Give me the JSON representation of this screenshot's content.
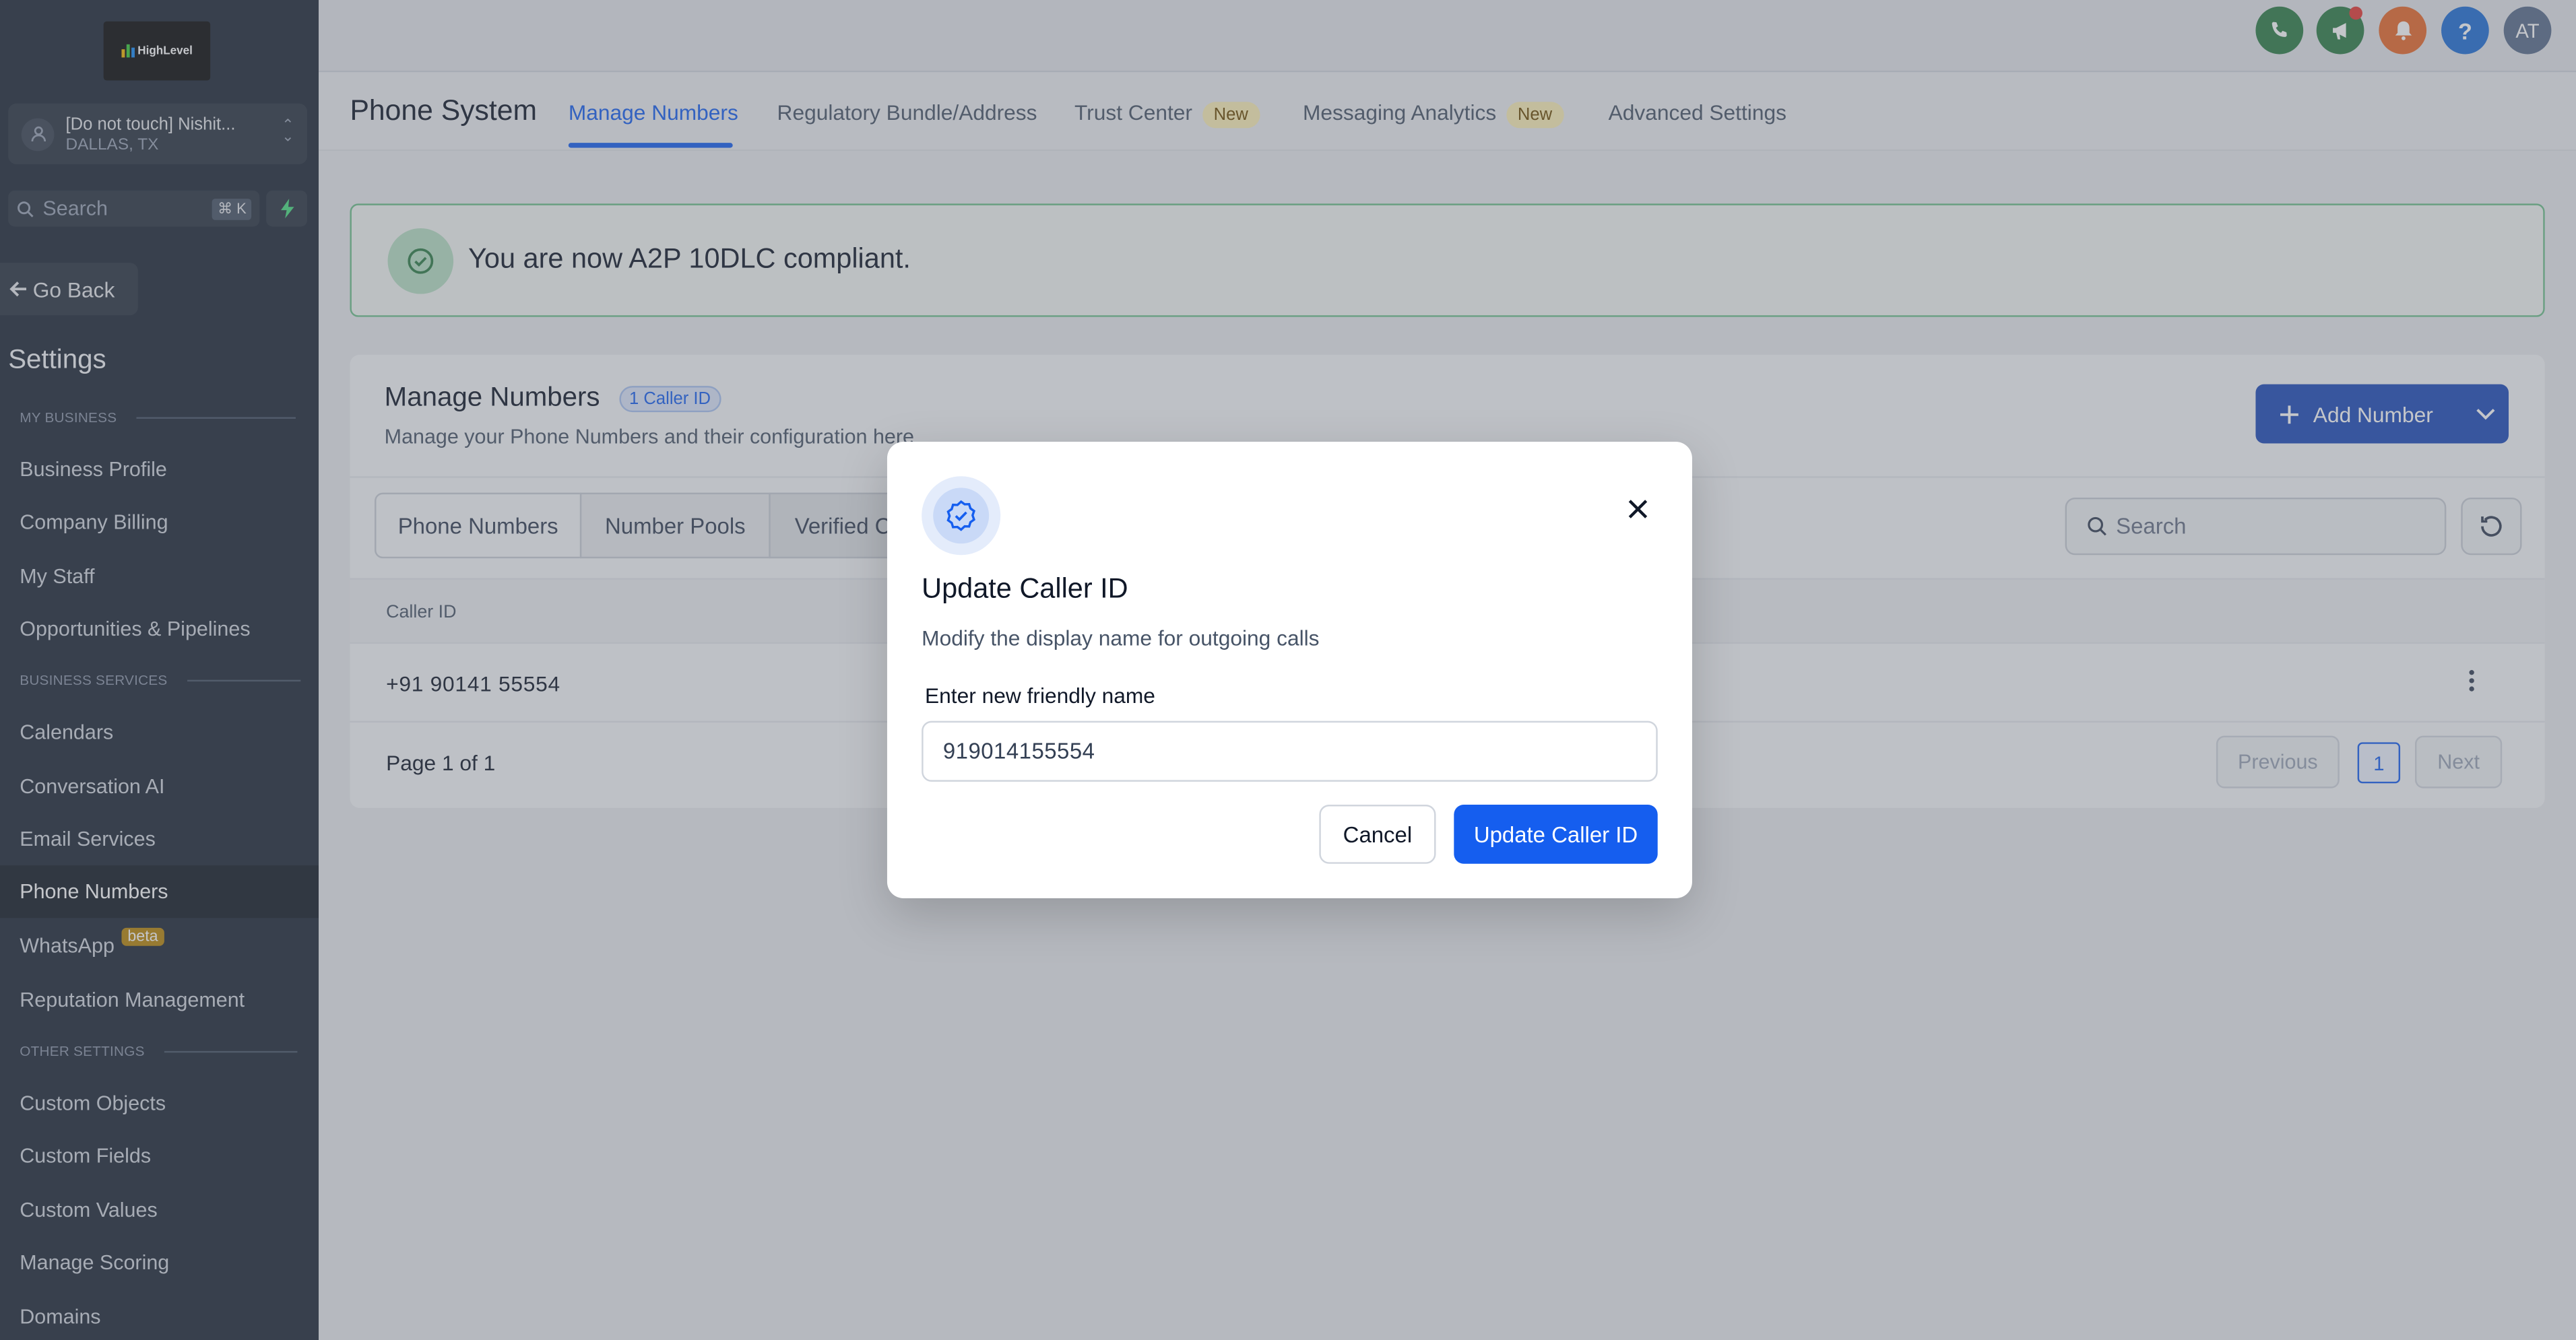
{
  "brand": {
    "logo_text": "HighLevel"
  },
  "location": {
    "name": "[Do not touch] Nishit...",
    "city": "DALLAS, TX"
  },
  "sidebar": {
    "search_placeholder": "Search",
    "shortcut": "⌘ K",
    "go_back": "Go Back",
    "settings_title": "Settings",
    "sections": {
      "my_business": "MY BUSINESS",
      "business_services": "BUSINESS SERVICES",
      "other_settings": "OTHER SETTINGS"
    },
    "items": [
      {
        "label": "Business Profile"
      },
      {
        "label": "Company Billing"
      },
      {
        "label": "My Staff"
      },
      {
        "label": "Opportunities & Pipelines"
      },
      {
        "label": "Calendars"
      },
      {
        "label": "Conversation AI"
      },
      {
        "label": "Email Services"
      },
      {
        "label": "Phone Numbers",
        "active": true
      },
      {
        "label": "WhatsApp",
        "badge": "beta"
      },
      {
        "label": "Reputation Management"
      },
      {
        "label": "Custom Objects"
      },
      {
        "label": "Custom Fields"
      },
      {
        "label": "Custom Values"
      },
      {
        "label": "Manage Scoring"
      },
      {
        "label": "Domains"
      }
    ]
  },
  "topbar": {
    "icons": [
      {
        "name": "phone-icon",
        "color": "#2e7d46"
      },
      {
        "name": "megaphone-icon",
        "color": "#2e7d46"
      },
      {
        "name": "bell-icon",
        "color": "#e8692b"
      },
      {
        "name": "help-icon",
        "color": "#1f6fd6"
      }
    ],
    "avatar_initials": "AT"
  },
  "subnav": {
    "title": "Phone System",
    "tabs": [
      {
        "label": "Manage Numbers",
        "active": true
      },
      {
        "label": "Regulatory Bundle/Address"
      },
      {
        "label": "Trust Center",
        "badge": "New"
      },
      {
        "label": "Messaging Analytics",
        "badge": "New"
      },
      {
        "label": "Advanced Settings"
      }
    ]
  },
  "banner": {
    "text": "You are now A2P 10DLC compliant."
  },
  "manage": {
    "title": "Manage Numbers",
    "badge": "1 Caller ID",
    "subtitle": "Manage your Phone Numbers and their configuration here",
    "add_button": "Add Number",
    "segments": [
      "Phone Numbers",
      "Number Pools",
      "Verified C"
    ],
    "search_placeholder": "Search",
    "table": {
      "columns": [
        "Caller ID"
      ],
      "rows": [
        {
          "caller_id": "+91 90141 55554"
        }
      ]
    },
    "pagination": {
      "info": "Page 1 of 1",
      "previous": "Previous",
      "current": "1",
      "next": "Next"
    }
  },
  "modal": {
    "title": "Update Caller ID",
    "subtitle": "Modify the display name for outgoing calls",
    "field_label": "Enter new friendly name",
    "field_value": "919014155554",
    "cancel": "Cancel",
    "submit": "Update Caller ID"
  },
  "colors": {
    "accent": "#155eef",
    "sidebar_bg": "#1e2836",
    "success": "#6fc08c"
  }
}
